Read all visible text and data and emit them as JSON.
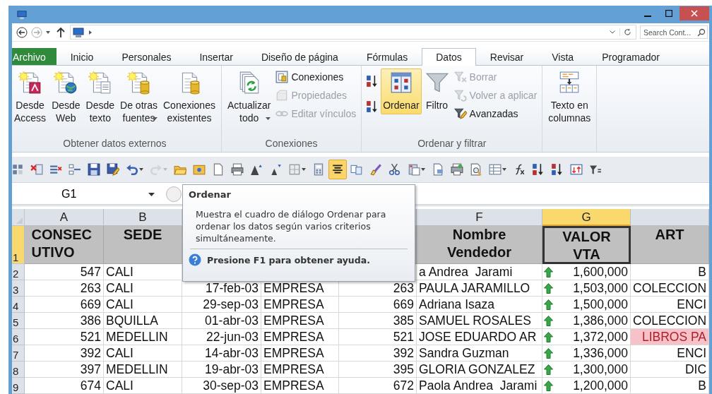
{
  "address_bar": {
    "search_placeholder": "Search Cont..."
  },
  "ribbon_tabs": [
    {
      "label": "Archivo",
      "kind": "file",
      "selected": false
    },
    {
      "label": "Inicio",
      "kind": "tab",
      "selected": false
    },
    {
      "label": "Personales",
      "kind": "tab",
      "selected": false
    },
    {
      "label": "Insertar",
      "kind": "tab",
      "selected": false
    },
    {
      "label": "Diseño de página",
      "kind": "tab",
      "selected": false
    },
    {
      "label": "Fórmulas",
      "kind": "tab",
      "selected": false
    },
    {
      "label": "Datos",
      "kind": "tab",
      "selected": true
    },
    {
      "label": "Revisar",
      "kind": "tab",
      "selected": false
    },
    {
      "label": "Vista",
      "kind": "tab",
      "selected": false
    },
    {
      "label": "Programador",
      "kind": "tab",
      "selected": false
    }
  ],
  "ribbon_groups": [
    {
      "label": "Obtener datos externos",
      "controls": [
        {
          "kind": "large",
          "label": "Desde\nAccess",
          "dropdown": false,
          "selected": false
        },
        {
          "kind": "large",
          "label": "Desde\nWeb",
          "dropdown": false,
          "selected": false
        },
        {
          "kind": "large",
          "label": "Desde\ntexto",
          "dropdown": false,
          "selected": false
        },
        {
          "kind": "large",
          "label": "De otras\nfuentes",
          "dropdown": true,
          "selected": false
        },
        {
          "kind": "large",
          "label": "Conexiones\nexistentes",
          "dropdown": false,
          "selected": false
        }
      ]
    },
    {
      "label": "Conexiones",
      "controls": [
        {
          "kind": "large",
          "label": "Actualizar\ntodo",
          "dropdown": true,
          "selected": false
        },
        {
          "kind": "small_stack",
          "items": [
            {
              "label": "Conexiones",
              "disabled": false
            },
            {
              "label": "Propiedades",
              "disabled": true
            },
            {
              "label": "Editar vínculos",
              "disabled": true
            }
          ]
        }
      ]
    },
    {
      "label": "Ordenar y filtrar",
      "controls": [
        {
          "kind": "sort_stack"
        },
        {
          "kind": "large",
          "label": "Ordenar",
          "dropdown": false,
          "selected": true
        },
        {
          "kind": "large",
          "label": "Filtro",
          "dropdown": false,
          "selected": false
        },
        {
          "kind": "small_stack",
          "items": [
            {
              "label": "Borrar",
              "disabled": true
            },
            {
              "label": "Volver a aplicar",
              "disabled": true
            },
            {
              "label": "Avanzadas",
              "disabled": false
            }
          ]
        }
      ]
    },
    {
      "controls": [
        {
          "kind": "large",
          "label": "Texto en\ncolumnas",
          "dropdown": false,
          "selected": false
        }
      ]
    }
  ],
  "quick_toolbar": [
    {
      "selected": false,
      "dropdown": false,
      "disabled": false
    },
    {
      "selected": false,
      "dropdown": false,
      "disabled": false
    },
    {
      "selected": false,
      "dropdown": false,
      "disabled": false
    },
    {
      "selected": false,
      "dropdown": false,
      "disabled": false
    },
    {
      "selected": false,
      "dropdown": false,
      "disabled": false
    },
    {
      "selected": false,
      "dropdown": false,
      "disabled": false
    },
    {
      "selected": false,
      "dropdown": true,
      "disabled": false
    },
    {
      "selected": false,
      "dropdown": true,
      "disabled": true
    },
    {
      "selected": false,
      "dropdown": false,
      "disabled": false
    },
    {
      "selected": false,
      "dropdown": false,
      "disabled": false
    },
    {
      "selected": false,
      "dropdown": false,
      "disabled": false
    },
    {
      "selected": false,
      "dropdown": false,
      "disabled": false
    },
    {
      "selected": false,
      "dropdown": false,
      "disabled": false
    },
    {
      "selected": false,
      "dropdown": false,
      "disabled": false
    },
    {
      "selected": false,
      "dropdown": true,
      "disabled": false
    },
    {
      "selected": false,
      "dropdown": false,
      "disabled": false
    },
    {
      "selected": true,
      "dropdown": false,
      "disabled": false
    },
    {
      "selected": false,
      "dropdown": false,
      "disabled": false
    },
    {
      "selected": false,
      "dropdown": false,
      "disabled": false
    },
    {
      "selected": false,
      "dropdown": false,
      "disabled": false
    },
    {
      "selected": false,
      "dropdown": true,
      "disabled": false
    },
    {
      "selected": false,
      "dropdown": false,
      "disabled": false
    },
    {
      "selected": false,
      "dropdown": false,
      "disabled": false
    },
    {
      "selected": false,
      "dropdown": false,
      "disabled": false
    },
    {
      "selected": false,
      "dropdown": true,
      "disabled": false
    },
    {
      "selected": false,
      "dropdown": false,
      "disabled": false
    },
    {
      "selected": false,
      "dropdown": false,
      "disabled": false
    },
    {
      "selected": false,
      "dropdown": false,
      "disabled": false
    },
    {
      "selected": false,
      "dropdown": false,
      "disabled": false
    },
    {
      "selected": false,
      "dropdown": false,
      "disabled": false
    }
  ],
  "name_box": "G1",
  "tooltip": {
    "title": "Ordenar",
    "body": "Muestra el cuadro de diálogo Ordenar para ordenar los datos según varios criterios simultáneamente.",
    "help": "Presione F1 para obtener ayuda."
  },
  "sheet": {
    "columns": [
      {
        "label": "A",
        "selected": false
      },
      {
        "label": "B",
        "selected": false
      },
      {
        "label": "F",
        "selected": false
      },
      {
        "label": "G",
        "selected": true
      },
      {
        "selected": false
      }
    ],
    "header_row": {
      "number": "1",
      "selected": true,
      "cells": [
        {
          "text": "CONSECUTIVO",
          "selected": false
        },
        {
          "text": "SEDE",
          "selected": false
        },
        {
          "text": "Nombre\nVendedor",
          "selected": false
        },
        {
          "text": "VALOR\nVTA",
          "selected": true
        },
        {
          "text": "ART",
          "selected": false
        }
      ]
    },
    "rows": [
      {
        "number": "2",
        "selected": false,
        "consecutivo": "547",
        "sede": "CALI",
        "nombre_vendedor": "a Andrea  Jarami",
        "valor_vta": "1,600,000",
        "column_8": "B",
        "highlight": false
      },
      {
        "number": "3",
        "selected": false,
        "consecutivo": "263",
        "sede": "CALI",
        "column_3": "17-feb-03",
        "column_4": "EMPRESA",
        "column_5": "263",
        "nombre_vendedor": "PAULA JARAMILLO",
        "valor_vta": "1,503,000",
        "column_8": "COLECCION",
        "highlight": false
      },
      {
        "number": "4",
        "selected": false,
        "consecutivo": "669",
        "sede": "CALI",
        "column_3": "29-sep-03",
        "column_4": "EMPRESA",
        "column_5": "669",
        "nombre_vendedor": "Adriana Isaza",
        "valor_vta": "1,500,000",
        "column_8": "ENCI",
        "highlight": false
      },
      {
        "number": "5",
        "selected": false,
        "consecutivo": "386",
        "sede": "BQUILLA",
        "column_3": "01-abr-03",
        "column_4": "EMPRESA",
        "column_5": "385",
        "nombre_vendedor": "SAMUEL ROSALES",
        "valor_vta": "1,386,000",
        "column_8": "COLECCION",
        "highlight": false
      },
      {
        "number": "6",
        "selected": false,
        "consecutivo": "521",
        "sede": "MEDELLIN",
        "column_3": "22-jun-03",
        "column_4": "EMPRESA",
        "column_5": "521",
        "nombre_vendedor": "JOSE EDUARDO AR",
        "valor_vta": "1,372,000",
        "column_8": "LIBROS PA",
        "highlight": true
      },
      {
        "number": "7",
        "selected": false,
        "consecutivo": "392",
        "sede": "CALI",
        "column_3": "14-abr-03",
        "column_4": "EMPRESA",
        "column_5": "392",
        "nombre_vendedor": "Sandra Guzman",
        "valor_vta": "1,336,000",
        "column_8": "ENCI",
        "highlight": false
      },
      {
        "number": "8",
        "selected": false,
        "consecutivo": "397",
        "sede": "MEDELLIN",
        "column_3": "19-abr-03",
        "column_4": "EMPRESA",
        "column_5": "395",
        "nombre_vendedor": "GLORIA GONZALEZ",
        "valor_vta": "1,300,000",
        "column_8": "DIC",
        "highlight": false
      },
      {
        "number": "9",
        "selected": false,
        "consecutivo": "674",
        "sede": "CALI",
        "column_3": "30-sep-03",
        "column_4": "EMPRESA",
        "column_5": "672",
        "nombre_vendedor": "Paola Andrea  Jarami",
        "valor_vta": "1,200,000",
        "column_8": "B",
        "highlight": false
      }
    ]
  }
}
